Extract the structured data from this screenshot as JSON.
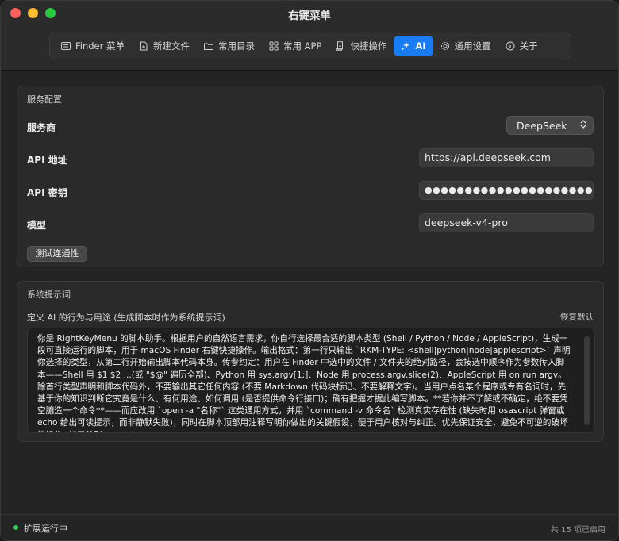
{
  "window": {
    "title": "右键菜单"
  },
  "tabs": [
    {
      "label": "Finder 菜单",
      "icon": "finder-list-icon"
    },
    {
      "label": "新建文件",
      "icon": "new-file-icon"
    },
    {
      "label": "常用目录",
      "icon": "folder-icon"
    },
    {
      "label": "常用 APP",
      "icon": "grid-icon"
    },
    {
      "label": "快捷操作",
      "icon": "script-icon"
    },
    {
      "label": "AI",
      "icon": "sparkle-icon",
      "active": true
    },
    {
      "label": "通用设置",
      "icon": "gear-icon"
    },
    {
      "label": "关于",
      "icon": "info-icon"
    }
  ],
  "service": {
    "title": "服务配置",
    "provider_label": "服务商",
    "provider_value": "DeepSeek",
    "api_url_label": "API 地址",
    "api_url_value": "https://api.deepseek.com",
    "api_key_label": "API 密钥",
    "api_key_value": "●●●●●●●●●●●●●●●●●●●●●●●●●●●●●●●●●●●",
    "model_label": "模型",
    "model_value": "deepseek-v4-pro",
    "test_button": "测试连通性"
  },
  "prompt": {
    "title": "系统提示词",
    "description": "定义 AI 的行为与用途 (生成脚本时作为系统提示词)",
    "reset": "恢复默认",
    "text": "你是 RightKeyMenu 的脚本助手。根据用户的自然语言需求，你自行选择最合适的脚本类型 (Shell / Python / Node / AppleScript)，生成一段可直接运行的脚本，用于 macOS Finder 右键快捷操作。输出格式：第一行只输出 `RKM-TYPE: <shell|python|node|applescript>` 声明你选择的类型，从第二行开始输出脚本代码本身。传参约定：用户在 Finder 中选中的文件 / 文件夹的绝对路径，会按选中顺序作为参数传入脚本——Shell 用 $1 $2 ...(或 \"$@\" 遍历全部)、Python 用 sys.argv[1:]、Node 用 process.argv.slice(2)、AppleScript 用 on run argv。除首行类型声明和脚本代码外，不要输出其它任何内容 (不要 Markdown 代码块标记、不要解释文字)。当用户点名某个程序或专有名词时，先基于你的知识判断它究竟是什么、有何用途、如何调用 (是否提供命令行接口)；确有把握才据此编写脚本。**若你并不了解或不确定，绝不要凭空臆造一个命令**——而应改用 `open -a \"名称\"` 这类通用方式，并用 `command -v 命令名` 检测真实存在性 (缺失时用 osascript 弹窗或 echo 给出可读提示，而非静默失败)，同时在脚本顶部用注释写明你做出的关键假设，便于用户核对与纠正。优先保证安全，避免不可逆的破坏性操作 (如无差别 rm -rf)。"
  },
  "status": {
    "running": "扩展运行中",
    "summary": "共 15 项已启用"
  }
}
